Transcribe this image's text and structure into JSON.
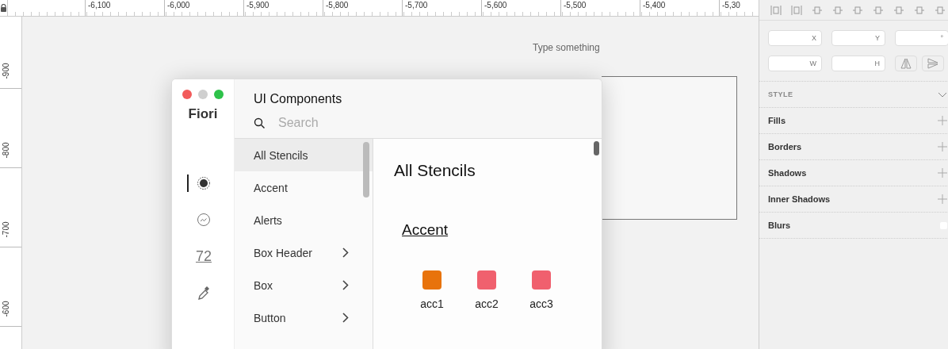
{
  "rulers": {
    "horizontal": [
      "-6,100",
      "-6,000",
      "-5,900",
      "-5,800",
      "-5,700",
      "-5,600",
      "-5,500",
      "-5,400",
      "-5,30"
    ],
    "vertical": [
      "-900",
      "-800",
      "-700",
      "-600"
    ]
  },
  "canvas": {
    "text_layer": "Type something"
  },
  "plugin": {
    "brand": "Fiori",
    "tabs": [
      {
        "kind": "color",
        "selected": true
      },
      {
        "kind": "icon",
        "selected": false
      },
      {
        "kind": "text",
        "label": "72",
        "selected": false
      },
      {
        "kind": "picker",
        "selected": false
      }
    ],
    "title": "UI Components",
    "search": {
      "placeholder": "Search"
    },
    "categories": [
      {
        "label": "All Stencils",
        "selected": true,
        "expandable": false
      },
      {
        "label": "Accent",
        "selected": false,
        "expandable": false
      },
      {
        "label": "Alerts",
        "selected": false,
        "expandable": false
      },
      {
        "label": "Box Header",
        "selected": false,
        "expandable": true
      },
      {
        "label": "Box",
        "selected": false,
        "expandable": true
      },
      {
        "label": "Button",
        "selected": false,
        "expandable": true
      }
    ],
    "content": {
      "heading": "All Stencils",
      "section": "Accent",
      "swatches": [
        {
          "label": "acc1",
          "color": "#e8730c"
        },
        {
          "label": "acc2",
          "color": "#f0606e"
        },
        {
          "label": "acc3",
          "color": "#f0606e"
        }
      ]
    }
  },
  "inspector": {
    "position_fields": [
      {
        "label": "X"
      },
      {
        "label": "Y"
      },
      {
        "label": "°"
      }
    ],
    "size_fields": [
      {
        "label": "W"
      },
      {
        "label": "H"
      }
    ],
    "style_title": "STYLE",
    "sections": [
      {
        "label": "Fills",
        "kind": "add"
      },
      {
        "label": "Borders",
        "kind": "add"
      },
      {
        "label": "Shadows",
        "kind": "add"
      },
      {
        "label": "Inner Shadows",
        "kind": "add"
      },
      {
        "label": "Blurs",
        "kind": "toggle",
        "checked": false
      }
    ]
  }
}
